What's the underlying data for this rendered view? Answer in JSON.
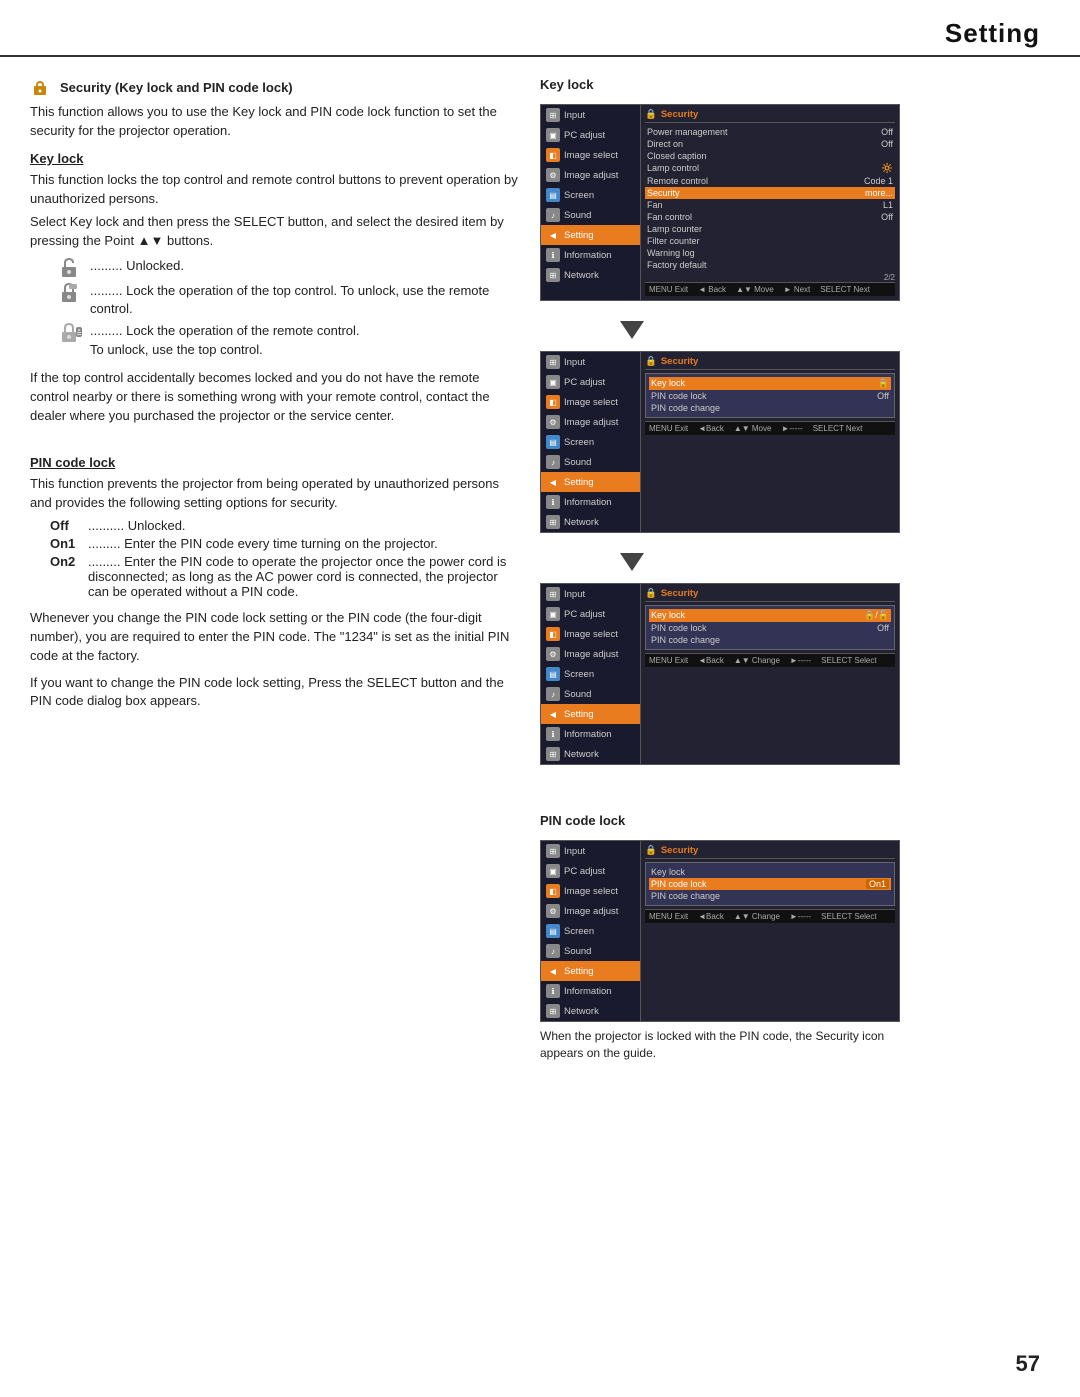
{
  "page": {
    "title": "Setting",
    "page_number": "57"
  },
  "left_col": {
    "security_title": "Security (Key lock and PIN code lock)",
    "security_desc": "This function allows you to use the Key lock and PIN code lock function to set the security for the projector operation.",
    "key_lock_title": "Key lock",
    "key_lock_desc": "This function locks the top control and remote control buttons to prevent operation by unauthorized persons.",
    "key_lock_inst": "Select Key lock and then press the SELECT button, and select the desired item by pressing the Point ▲▼ buttons.",
    "unlocked_text": "......... Unlocked.",
    "lock_top_text": "......... Lock the operation of the top control. To unlock, use the remote control.",
    "lock_remote_text": "......... Lock the operation of the remote control.",
    "lock_remote_text2": "To unlock, use the top control.",
    "key_lock_warning": "If the top control accidentally becomes locked and you do not have the remote control nearby or there is something wrong with your remote control, contact the dealer where you purchased the projector or the service center.",
    "pin_code_title": "PIN code lock",
    "pin_code_desc": "This function prevents the projector from being operated by unauthorized persons and provides the following setting options for security.",
    "pin_off_label": "Off",
    "pin_off_text": ".......... Unlocked.",
    "pin_on1_label": "On1",
    "pin_on1_text": "......... Enter the PIN code every time turning on the projector.",
    "pin_on2_label": "On2",
    "pin_on2_text": "......... Enter the PIN code to operate the projector once the power cord is disconnected; as long as the AC power cord is connected, the projector can be operated without a PIN code.",
    "pin_note1": "Whenever you change the PIN code lock setting or the PIN code (the four-digit number), you are required to enter the PIN code. The \"1234\" is set as the initial PIN code at the factory.",
    "pin_note2": "If you want to change the PIN code lock setting, Press the SELECT button and the PIN code dialog box appears."
  },
  "right_col": {
    "key_lock_label": "Key lock",
    "pin_code_lock_label": "PIN code lock",
    "screen1": {
      "menu_items": [
        {
          "label": "Input",
          "icon": "grid"
        },
        {
          "label": "PC adjust",
          "icon": "monitor"
        },
        {
          "label": "Image select",
          "icon": "image"
        },
        {
          "label": "Image adjust",
          "icon": "sliders"
        },
        {
          "label": "Screen",
          "icon": "screen"
        },
        {
          "label": "Sound",
          "icon": "speaker"
        },
        {
          "label": "Setting",
          "icon": "gear",
          "active": true
        },
        {
          "label": "Information",
          "icon": "info"
        },
        {
          "label": "Network",
          "icon": "network"
        }
      ],
      "right_title": "Security",
      "right_rows": [
        {
          "label": "Power management",
          "value": "Off"
        },
        {
          "label": "Direct on",
          "value": "Off"
        },
        {
          "label": "Closed caption",
          "value": ""
        },
        {
          "label": "Lamp control",
          "value": ""
        },
        {
          "label": "Remote control",
          "value": "Code 1"
        },
        {
          "label": "Security",
          "value": "more...",
          "highlighted": true
        },
        {
          "label": "Fan",
          "value": "L1"
        },
        {
          "label": "Fan control",
          "value": "Off"
        },
        {
          "label": "Lamp counter",
          "value": ""
        },
        {
          "label": "Filter counter",
          "value": ""
        },
        {
          "label": "Warning log",
          "value": ""
        },
        {
          "label": "Factory default",
          "value": ""
        }
      ],
      "page_indicator": "2/2",
      "bottom_bar": [
        "MENU Exit",
        "◄ Back",
        "▲▼ Move",
        "► Next",
        "SELECT Next"
      ]
    },
    "screen2": {
      "right_title": "Security",
      "right_sub_title": "Key lock",
      "right_rows": [
        {
          "label": "Key lock",
          "value": "🔒",
          "highlighted": true
        },
        {
          "label": "PIN code lock",
          "value": "Off"
        },
        {
          "label": "PIN code change",
          "value": ""
        }
      ],
      "bottom_bar": [
        "MENU Exit",
        "◄Back",
        "▲▼ Move",
        "►-----",
        "SELECT Next"
      ]
    },
    "screen3": {
      "right_title": "Security",
      "right_sub_title": "Key lock",
      "right_rows": [
        {
          "label": "Key lock",
          "value": "🔒/🔓",
          "highlighted": true
        },
        {
          "label": "PIN code lock",
          "value": "Off"
        },
        {
          "label": "PIN code change",
          "value": ""
        }
      ],
      "bottom_bar": [
        "MENU Exit",
        "◄Back",
        "▲▼ Change",
        "►-----",
        "SELECT Select"
      ]
    },
    "screen4": {
      "right_title": "Security",
      "right_sub_title": "PIN code lock",
      "right_rows": [
        {
          "label": "Key lock",
          "value": ""
        },
        {
          "label": "PIN code lock",
          "value": "On1",
          "highlighted": true
        },
        {
          "label": "PIN code change",
          "value": ""
        }
      ],
      "bottom_bar": [
        "MENU Exit",
        "◄Back",
        "▲▼ Change",
        "►-----",
        "SELECT Select"
      ]
    },
    "screen4_caption": "When the projector is locked with the PIN code, the Security icon appears on the guide."
  }
}
